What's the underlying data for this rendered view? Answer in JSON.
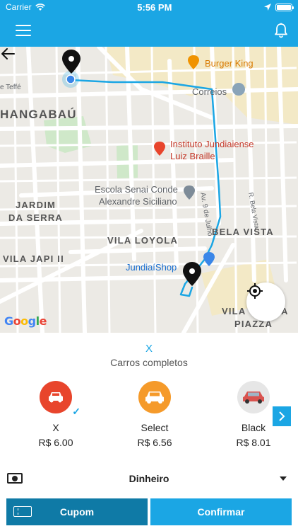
{
  "status": {
    "carrier": "Carrier",
    "time": "5:56 PM"
  },
  "nav": {
    "menu_icon": "hamburger-menu-icon",
    "notification_icon": "bell-icon"
  },
  "map": {
    "labels": {
      "burger_king": "Burger King",
      "correios": "Correios",
      "hangabau": "HANGABAÚ",
      "instituto_line1": "Instituto Jundiaiense",
      "instituto_line2": "Luiz Braille",
      "escola_line1": "Escola Senai Conde",
      "escola_line2": "Alexandre Siciliano",
      "jardim_line1": "JARDIM",
      "jardim_line2": "DA SERRA",
      "vila_loyola": "VILA LOYOLA",
      "vila_japi": "VILA JAPI II",
      "bela_vista": "BELA VISTA",
      "jundiai_shop": "JundiaíShop",
      "vila_piazza_line1": "VILA",
      "vila_piazza_line1b": "A",
      "vila_piazza_line2": "PIAZZA",
      "av_9_julho": "Av. 9 de Julho",
      "r_bela_vista": "R. Bela Vista",
      "teffe": "e Teffé"
    },
    "google": [
      "G",
      "o",
      "o",
      "g",
      "l",
      "e"
    ],
    "google_colors": [
      "#4285F4",
      "#EA4335",
      "#FBBC05",
      "#4285F4",
      "#34A853",
      "#EA4335"
    ],
    "route_color": "#1ba6e4"
  },
  "panel": {
    "category_title": "X",
    "category_subtitle": "Carros completos",
    "cars": [
      {
        "name": "X",
        "price": "R$ 6.00",
        "color": "#e8452c",
        "selected": true
      },
      {
        "name": "Select",
        "price": "R$ 6.56",
        "color": "#f59a2a",
        "selected": false
      },
      {
        "name": "Black",
        "price": "R$ 8.01",
        "color": "#e6e6e6",
        "selected": false
      }
    ],
    "payment_label": "Dinheiro",
    "coupon_label": "Cupom",
    "confirm_label": "Confirmar"
  },
  "colors": {
    "accent": "#1ba6e4",
    "accent_dark": "#0f7aa6"
  }
}
